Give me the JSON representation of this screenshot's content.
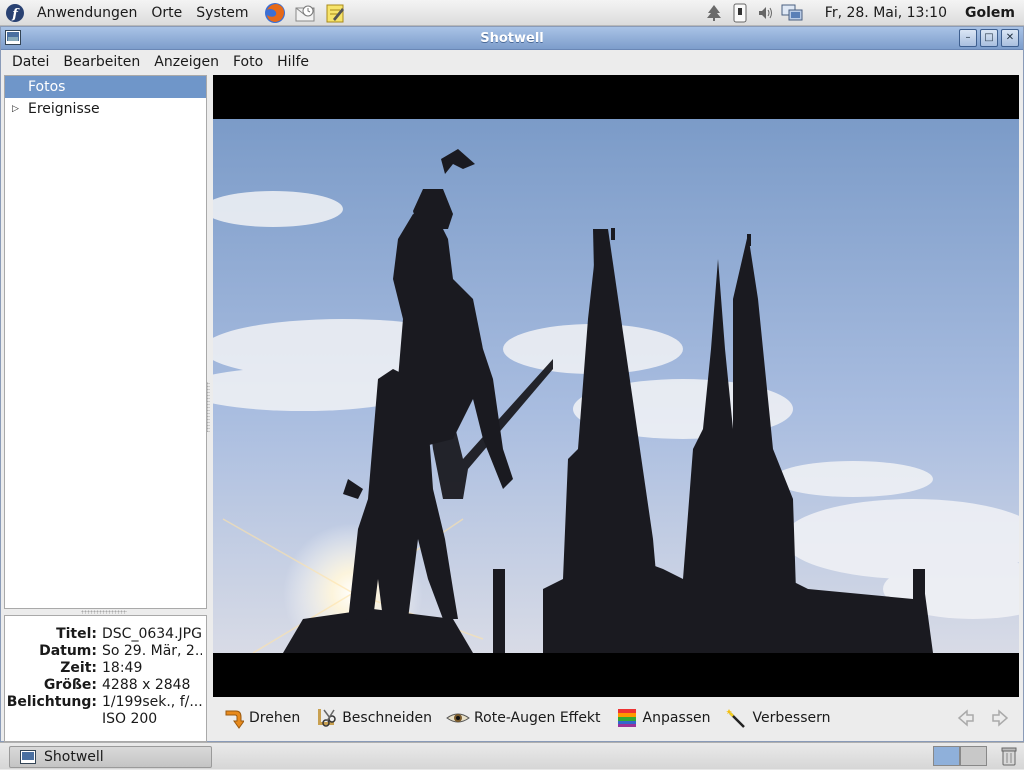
{
  "panel": {
    "menus": [
      "Anwendungen",
      "Orte",
      "System"
    ],
    "clock": "Fr, 28. Mai, 13:10",
    "user": "Golem"
  },
  "window": {
    "title": "Shotwell"
  },
  "menubar": [
    "Datei",
    "Bearbeiten",
    "Anzeigen",
    "Foto",
    "Hilfe"
  ],
  "sidebar": {
    "items": [
      {
        "label": "Fotos",
        "selected": true
      },
      {
        "label": "Ereignisse",
        "expandable": true
      }
    ]
  },
  "info": {
    "rows": [
      {
        "label": "Titel:",
        "value": "DSC_0634.JPG"
      },
      {
        "label": "Datum:",
        "value": "So 29. Mär, 2..."
      },
      {
        "label": "Zeit:",
        "value": "18:49"
      },
      {
        "label": "Größe:",
        "value": "4288 x 2848"
      },
      {
        "label": "Belichtung:",
        "value": "1/199sek., f/..."
      },
      {
        "label": "",
        "value": "ISO 200"
      }
    ]
  },
  "toolbar": {
    "rotate": "Drehen",
    "crop": "Beschneiden",
    "redeye": "Rote-Augen Effekt",
    "adjust": "Anpassen",
    "enhance": "Verbessern"
  },
  "taskbar": {
    "task": "Shotwell"
  },
  "colors": {
    "accent": "#6f96c9",
    "titlebar": "#8fadd8"
  }
}
